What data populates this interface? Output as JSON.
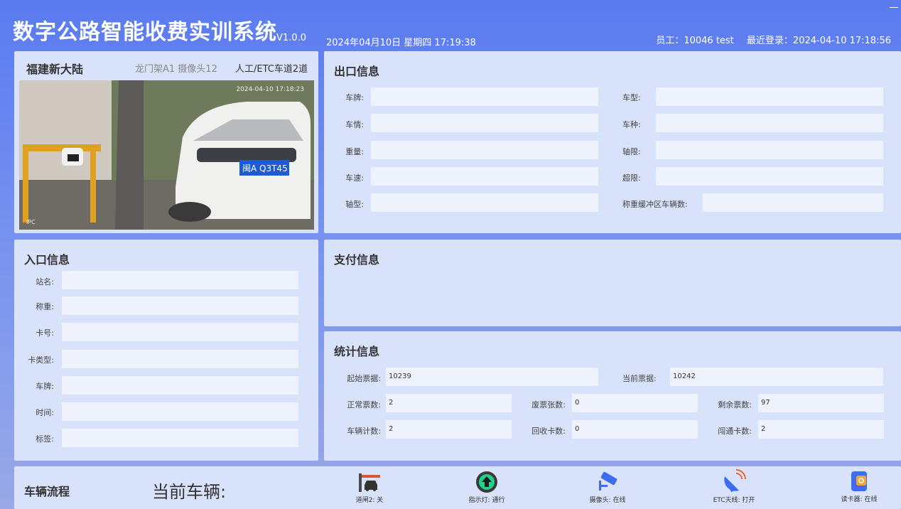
{
  "header": {
    "app_title": "数字公路智能收费实训系统",
    "version": "V1.0.0",
    "datetime": "2024年04月10日 星期四 17:19:38",
    "employee": "员工：10046 test",
    "last_login": "最近登录：2024-04-10 17:18:56"
  },
  "camera": {
    "location": "福建新大陆",
    "device": "龙门架A1  摄像头12",
    "lane": "人工/ETC车道2道",
    "timestamp": "2024-04-10 17:18:23",
    "ipc": "IPC",
    "plate": "闽A Q3T45"
  },
  "exit_info": {
    "title": "出口信息",
    "left_fields": [
      {
        "label": "车牌:",
        "value": ""
      },
      {
        "label": "车情:",
        "value": ""
      },
      {
        "label": "重量:",
        "value": ""
      },
      {
        "label": "车速:",
        "value": ""
      },
      {
        "label": "轴型:",
        "value": ""
      }
    ],
    "right_fields": [
      {
        "label": "车型:",
        "value": ""
      },
      {
        "label": "车种:",
        "value": ""
      },
      {
        "label": "轴限:",
        "value": ""
      },
      {
        "label": "超限:",
        "value": ""
      },
      {
        "label": "称重缓冲区车辆数:",
        "value": ""
      }
    ]
  },
  "entry_info": {
    "title": "入口信息",
    "fields": [
      {
        "label": "站名:",
        "value": ""
      },
      {
        "label": "称重:",
        "value": ""
      },
      {
        "label": "卡号:",
        "value": ""
      },
      {
        "label": "卡类型:",
        "value": ""
      },
      {
        "label": "车牌:",
        "value": ""
      },
      {
        "label": "时间:",
        "value": ""
      },
      {
        "label": "标签:",
        "value": ""
      }
    ]
  },
  "payment_info": {
    "title": "支付信息"
  },
  "stats_info": {
    "title": "统计信息",
    "start_ticket": {
      "label": "起始票据:",
      "value": "10239"
    },
    "current_ticket": {
      "label": "当前票据:",
      "value": "10242"
    },
    "normal_tickets": {
      "label": "正常票数:",
      "value": "2"
    },
    "void_tickets": {
      "label": "废票张数:",
      "value": "0"
    },
    "remaining_tickets": {
      "label": "剩余票数:",
      "value": "97"
    },
    "vehicle_count": {
      "label": "车辆计数:",
      "value": "2"
    },
    "recycled_cards": {
      "label": "回收卡数:",
      "value": "0"
    },
    "gate_cards": {
      "label": "闯通卡数:",
      "value": "2"
    }
  },
  "flow": {
    "title": "车辆流程",
    "current_vehicle_label": "当前车辆:",
    "devices": [
      {
        "icon": "barrier-gate-icon",
        "label": "道闸2: 关"
      },
      {
        "icon": "traffic-light-icon",
        "label": "指示灯: 通行"
      },
      {
        "icon": "camera-icon",
        "label": "摄像头: 在线"
      },
      {
        "icon": "etc-antenna-icon",
        "label": "ETC天线: 打开"
      },
      {
        "icon": "card-reader-icon",
        "label": "读卡器: 在线"
      }
    ]
  },
  "colors": {
    "background_gradient_top": "#5a7bf0",
    "panel": "#d9e2fb",
    "field": "#eef2fd",
    "traffic_light_green": "#1fd38a",
    "barrier_red": "#d9542f"
  }
}
